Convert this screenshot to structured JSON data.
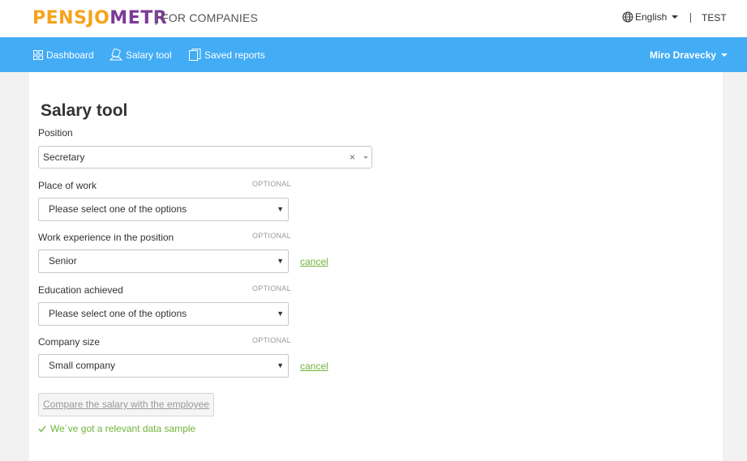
{
  "header": {
    "logo_part1": "PENSJO",
    "logo_part2": "METR",
    "subtitle": "FOR COMPANIES",
    "language": "English",
    "environment": "TEST",
    "colors": {
      "logo_orange": "#f7a21b",
      "logo_purple": "#7b3a96"
    }
  },
  "nav": {
    "items": [
      {
        "label": "Dashboard",
        "icon": "grid-icon"
      },
      {
        "label": "Salary tool",
        "icon": "calculator-icon"
      },
      {
        "label": "Saved reports",
        "icon": "documents-icon"
      }
    ],
    "user": "Miro Dravecky",
    "color": "#42acf5"
  },
  "main": {
    "title": "Salary tool",
    "position": {
      "label": "Position",
      "value": "Secretary",
      "clear": "×"
    },
    "place_of_work": {
      "label": "Place of work",
      "optional": "OPTIONAL",
      "value": "Please select one of the options"
    },
    "experience": {
      "label": "Work experience in the position",
      "optional": "OPTIONAL",
      "value": "Senior",
      "cancel": "cancel"
    },
    "education": {
      "label": "Education achieved",
      "optional": "OPTIONAL",
      "value": "Please select one of the options"
    },
    "company_size": {
      "label": "Company size",
      "optional": "OPTIONAL",
      "value": "Small company",
      "cancel": "cancel"
    },
    "compare_button": "Compare the salary with the employee",
    "status": "We´ve got a relevant data sample",
    "accent_green": "#71b43a"
  }
}
